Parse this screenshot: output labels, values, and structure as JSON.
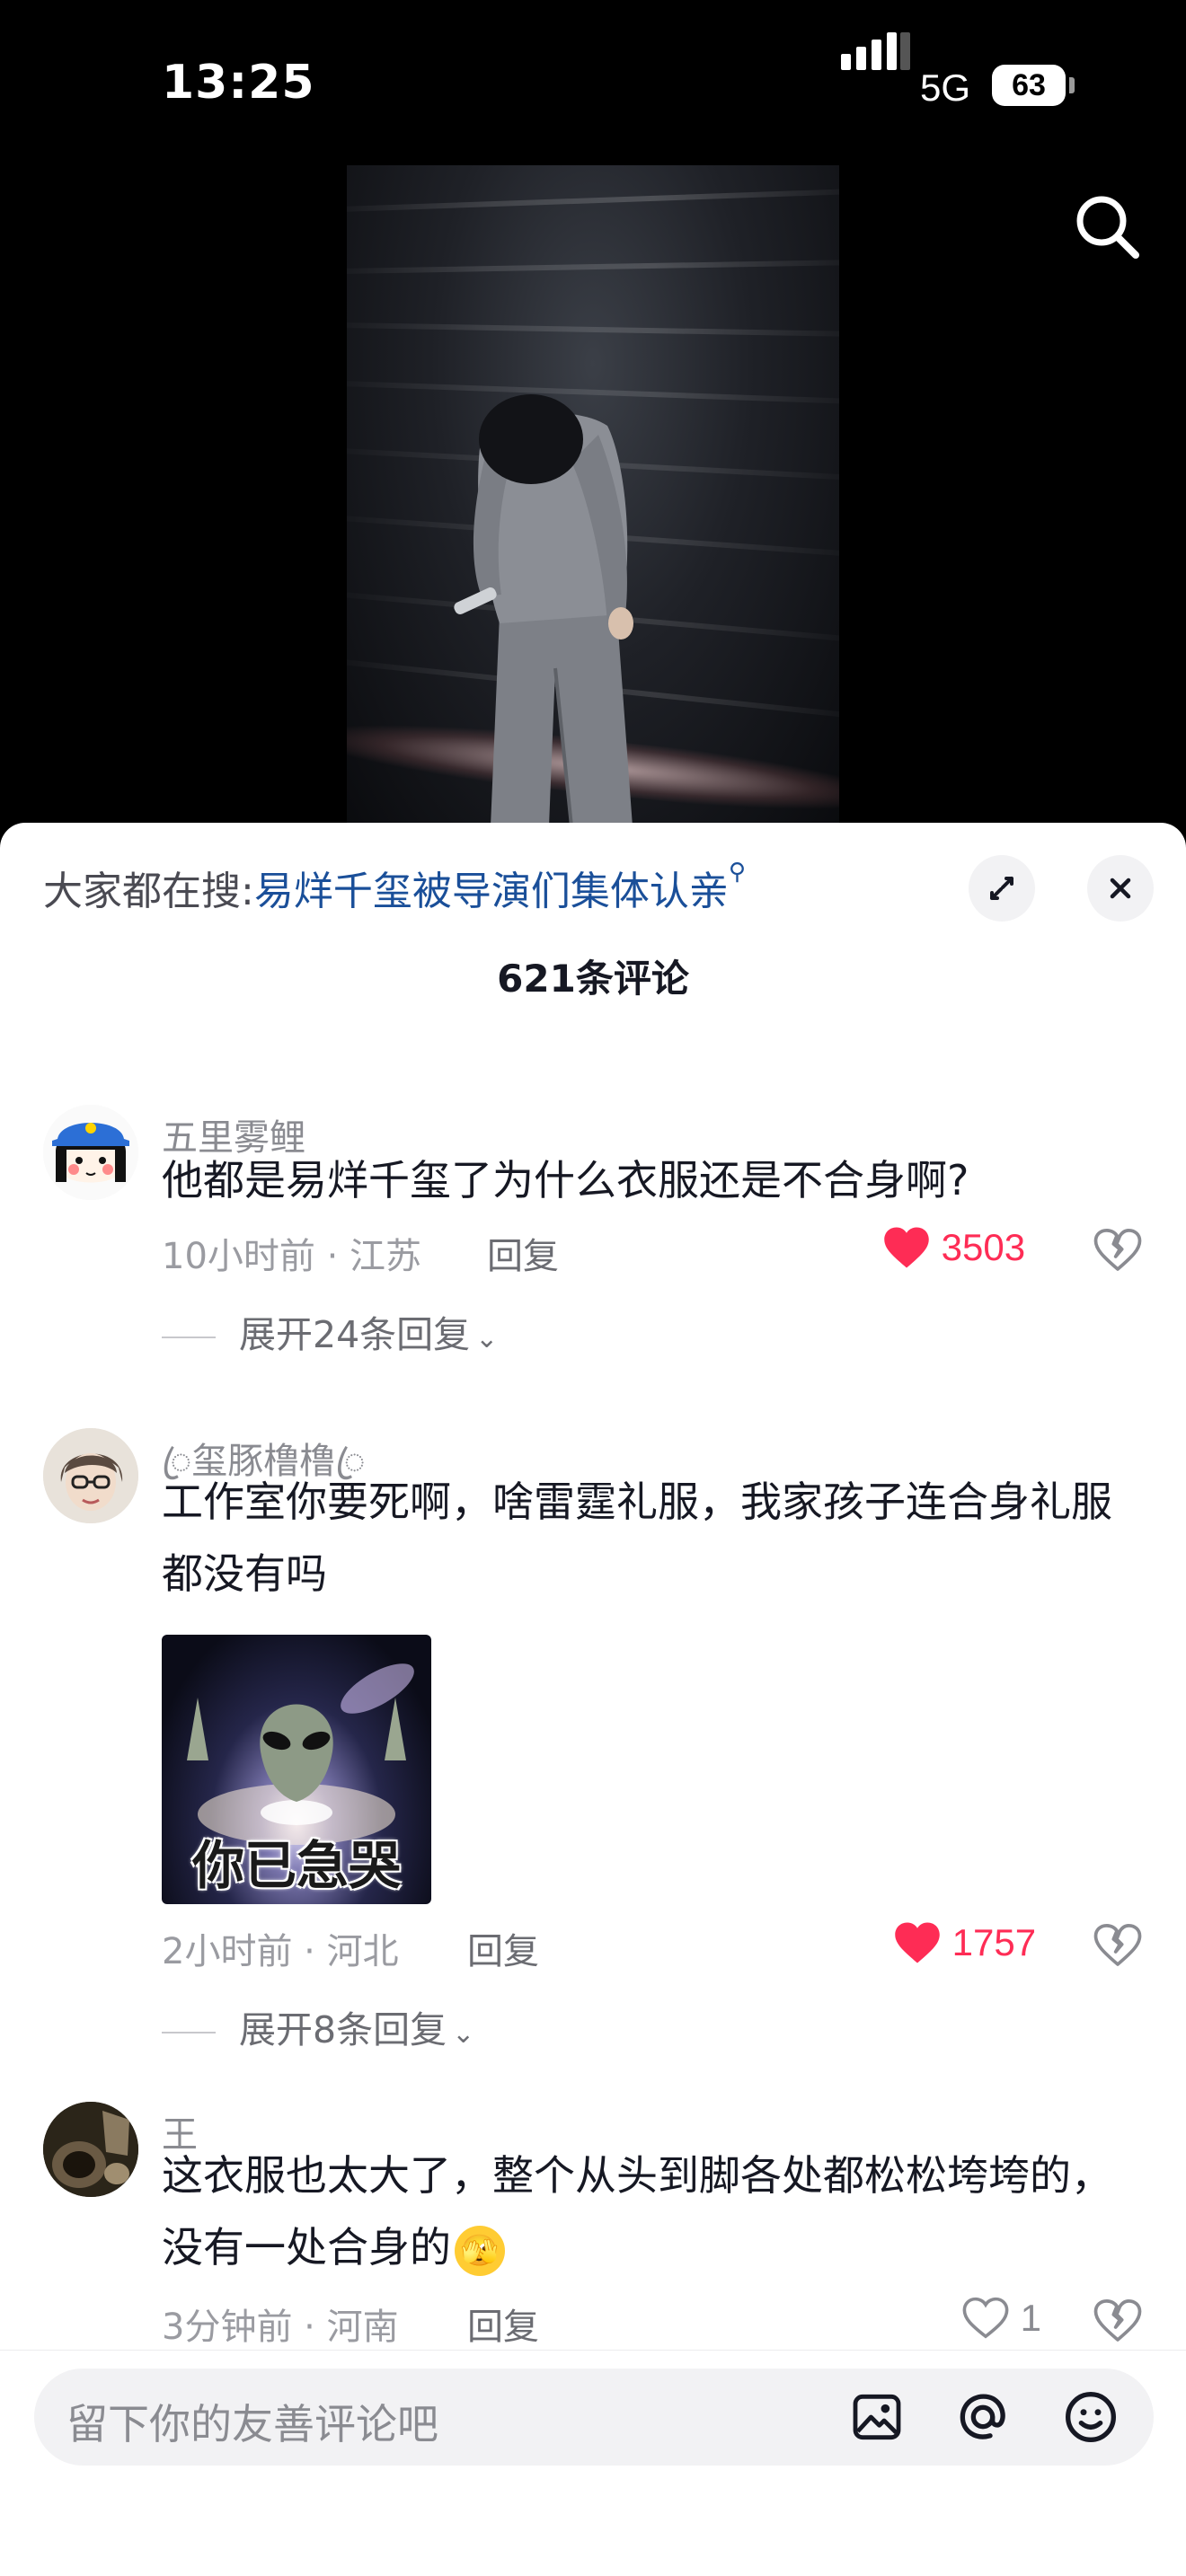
{
  "status": {
    "time": "13:25",
    "network": "5G",
    "battery": "63"
  },
  "video": {
    "search_icon": "search-icon"
  },
  "panel": {
    "hot_search_prefix": "大家都在搜:",
    "hot_search_term": "易烊千玺被导演们集体认亲",
    "comment_count": "621条评论",
    "icons": {
      "expand": "expand-icon",
      "close": "close-icon"
    }
  },
  "comments": [
    {
      "username": "五里雾鲤",
      "text": "他都是易烊千玺了为什么衣服还是不合身啊?",
      "time_location": "10小时前 · 江苏",
      "reply_label": "回复",
      "likes": "3503",
      "liked": true,
      "expand_label": "展开24条回复"
    },
    {
      "username": "ꦿ玺豚橹橹ꦿ",
      "text": "工作室你要死啊，啥雷霆礼服，我家孩子连合身礼服都没有吗",
      "sticker_caption": "你已急哭",
      "time_location": "2小时前 · 河北",
      "reply_label": "回复",
      "likes": "1757",
      "liked": true,
      "expand_label": "展开8条回复"
    },
    {
      "username": "王",
      "text": "这衣服也太大了，整个从头到脚各处都松松垮垮的，没有一处合身的",
      "text_emoji": "🫣",
      "time_location": "3分钟前 · 河南",
      "reply_label": "回复",
      "likes": "1",
      "liked": false
    }
  ],
  "input": {
    "placeholder": "留下你的友善评论吧",
    "icons": [
      "image-icon",
      "at-icon",
      "emoji-icon"
    ]
  },
  "colors": {
    "like_red": "#fe2c55",
    "link_blue": "#1a4f99"
  }
}
